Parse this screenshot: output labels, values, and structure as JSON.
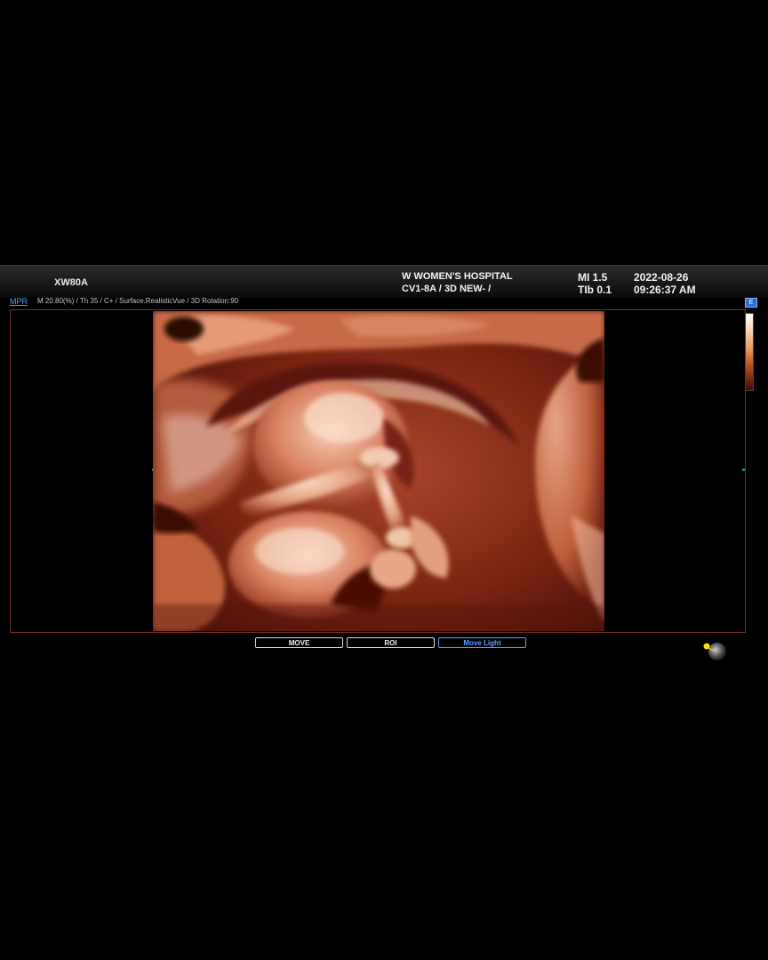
{
  "header": {
    "model": "XW80A",
    "hospital": "W WOMEN'S HOSPITAL",
    "probe_mode": "CV1-8A / 3D NEW- /",
    "mi": "MI  1.5",
    "tib": "TIb 0.1",
    "date": "2022-08-26",
    "time": "09:26:37 AM"
  },
  "status": {
    "mpr_label": "MPR",
    "params": "M 20.80(%) / Th 35 / C+ / Surface.RealisticVue / 3D Rotation:90",
    "corner_label": "E"
  },
  "colors": {
    "accent": "#5aa0ff",
    "frame": "#7a2a22",
    "skin_light": "#f2c4a8",
    "skin_mid": "#d2714c",
    "skin_dark": "#5a1408"
  },
  "icons": {
    "light_position": "light-bulb-icon"
  },
  "buttons": {
    "move": "MOVE",
    "roi": "ROI",
    "move_light": "Move Light",
    "active": "move_light"
  }
}
